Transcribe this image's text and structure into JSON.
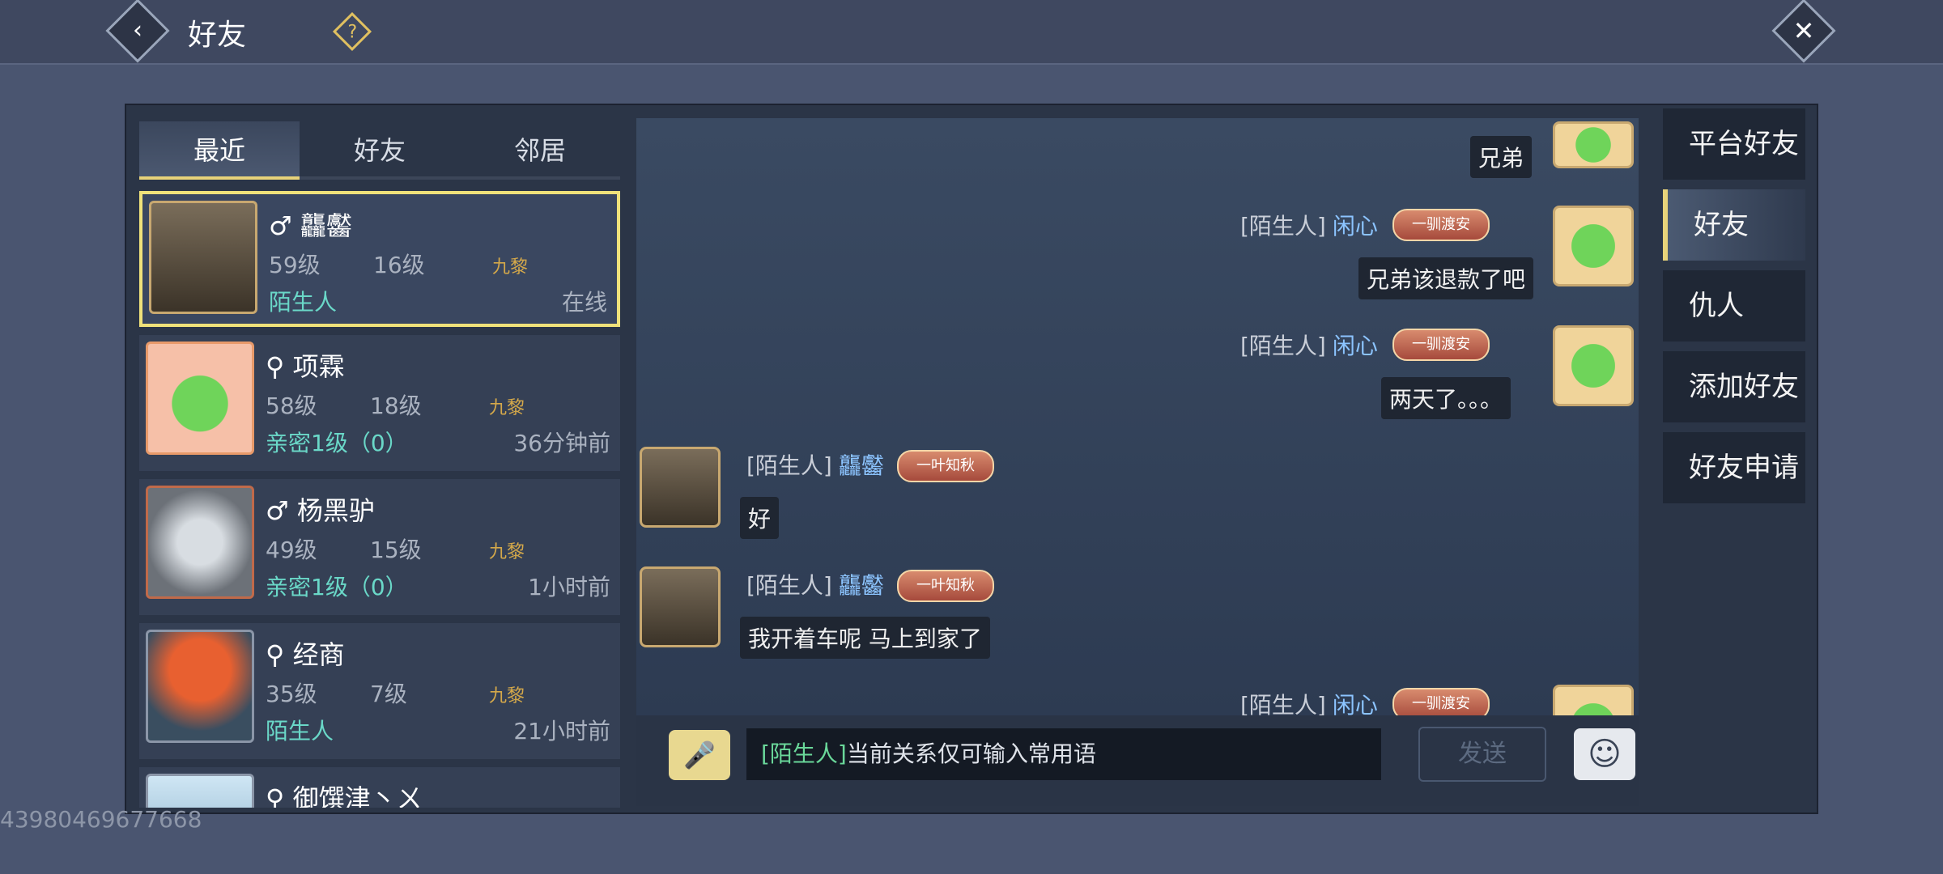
{
  "header": {
    "title": "好友",
    "back_icon": "‹",
    "help_icon": "?",
    "close_icon": "✕"
  },
  "tabs": [
    {
      "label": "最近",
      "active": true
    },
    {
      "label": "好友",
      "active": false
    },
    {
      "label": "邻居",
      "active": false
    }
  ],
  "friends": [
    {
      "gender": "♂",
      "name": "龘齾",
      "level": "59级",
      "rank": "16级",
      "badge": "九黎",
      "relation": "陌生人",
      "status": "在线"
    },
    {
      "gender": "⚲",
      "name": "项霖",
      "level": "58级",
      "rank": "18级",
      "badge": "九黎",
      "relation": "亲密1级（0）",
      "status": "36分钟前"
    },
    {
      "gender": "♂",
      "name": "杨黑驴",
      "level": "49级",
      "rank": "15级",
      "badge": "九黎",
      "relation": "亲密1级（0）",
      "status": "1小时前"
    },
    {
      "gender": "⚲",
      "name": "经商",
      "level": "35级",
      "rank": "7级",
      "badge": "九黎",
      "relation": "陌生人",
      "status": "21小时前"
    },
    {
      "gender": "⚲",
      "name": "御馔津丶ㄨ"
    }
  ],
  "chat": {
    "messages": [
      {
        "text": "兄弟"
      },
      {
        "sender_tag": "[陌生人]",
        "sender_name": "闲心",
        "title": "一驯渡安",
        "text": "兄弟该退款了吧"
      },
      {
        "sender_tag": "[陌生人]",
        "sender_name": "闲心",
        "title": "一驯渡安",
        "text": "两天了。。。"
      },
      {
        "sender_tag": "[陌生人]",
        "sender_name": "龘齾",
        "title": "一叶知秋",
        "text": "好"
      },
      {
        "sender_tag": "[陌生人]",
        "sender_name": "龘齾",
        "title": "一叶知秋",
        "text": "我开着车呢 马上到家了"
      },
      {
        "sender_tag": "[陌生人]",
        "sender_name": "闲心",
        "title": "一驯渡安"
      }
    ]
  },
  "input": {
    "prefix": "[陌生人]",
    "hint": "当前关系仅可输入常用语",
    "send_label": "发送",
    "voice_icon": "🎤",
    "emoji_icon": "☺"
  },
  "side_tabs": [
    {
      "label": "平台好友",
      "active": false
    },
    {
      "label": "好友",
      "active": true
    },
    {
      "label": "仇人",
      "active": false
    },
    {
      "label": "添加好友",
      "active": false
    },
    {
      "label": "好友申请",
      "active": false
    }
  ],
  "uid": "43980469677668",
  "colors": {
    "accent_gold": "#e8d37a",
    "relation_teal": "#6ad8c8",
    "name_blue": "#8cc4ff"
  }
}
